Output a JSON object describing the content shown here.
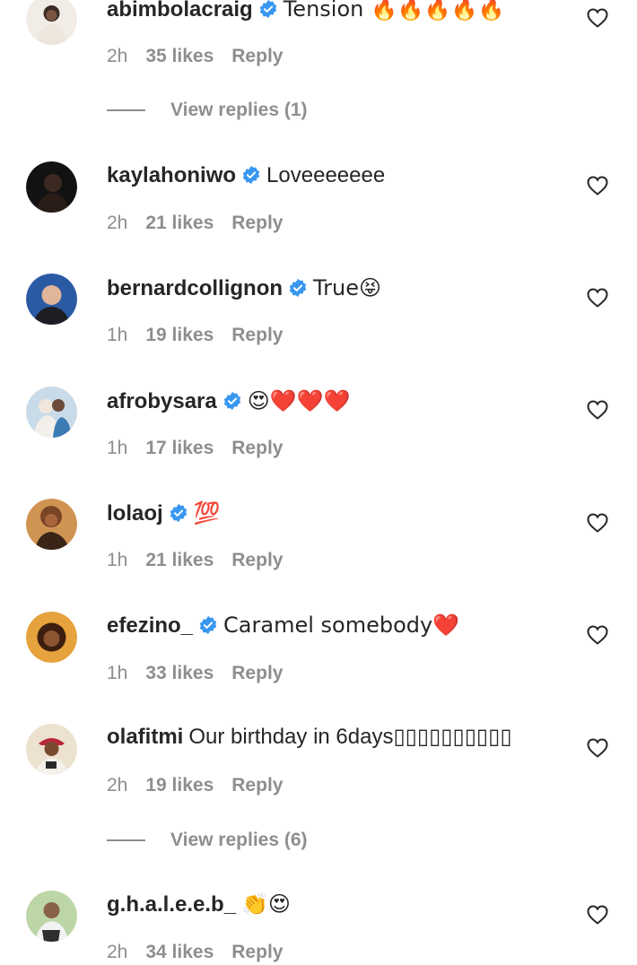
{
  "comments": [
    {
      "username": "abimbolacraig",
      "verified": true,
      "text": "Tension 🔥🔥🔥🔥🔥",
      "time": "2h",
      "likes": "35 likes",
      "reply": "Reply",
      "avatar_colors": [
        "#f4f1ec",
        "#2a2a2a"
      ]
    },
    {
      "username": "kaylahoniwo",
      "verified": true,
      "text": "Loveeeeeee",
      "time": "2h",
      "likes": "21 likes",
      "reply": "Reply",
      "avatar_colors": [
        "#101010",
        "#3a2a22"
      ]
    },
    {
      "username": "bernardcollignon",
      "verified": true,
      "text": "True😝",
      "time": "1h",
      "likes": "19 likes",
      "reply": "Reply",
      "avatar_colors": [
        "#2b5ea8",
        "#d4a88c"
      ]
    },
    {
      "username": "afrobysara",
      "verified": true,
      "text": "😍❤️❤️❤️",
      "time": "1h",
      "likes": "17 likes",
      "reply": "Reply",
      "avatar_colors": [
        "#bcd5e6",
        "#3c7ab4"
      ]
    },
    {
      "username": "lolaoj",
      "verified": true,
      "text": "💯",
      "time": "1h",
      "likes": "21 likes",
      "reply": "Reply",
      "avatar_colors": [
        "#c98a4a",
        "#5b2f1a"
      ]
    },
    {
      "username": "efezino_",
      "verified": true,
      "text": "Caramel somebody❤️",
      "time": "1h",
      "likes": "33 likes",
      "reply": "Reply",
      "avatar_colors": [
        "#e2a13c",
        "#3d1f10"
      ]
    },
    {
      "username": "olafitmi",
      "verified": false,
      "text": "Our birthday in 6days▯▯▯▯▯▯▯▯▯▯",
      "time": "2h",
      "likes": "19 likes",
      "reply": "Reply",
      "avatar_colors": [
        "#e8dcc6",
        "#b0273a"
      ]
    },
    {
      "username": "g.h.a.l.e.e.b_",
      "verified": false,
      "text": "👏😍",
      "time": "2h",
      "likes": "34 likes",
      "reply": "Reply",
      "avatar_colors": [
        "#b8d4a4",
        "#2e2e2e"
      ]
    }
  ],
  "view_replies": [
    {
      "label": "View replies (1)"
    },
    {
      "label": "View replies (6)"
    }
  ],
  "colors": {
    "text": "#262626",
    "meta": "#8e8e8e",
    "verified": "#3897f0",
    "background": "#ffffff"
  }
}
